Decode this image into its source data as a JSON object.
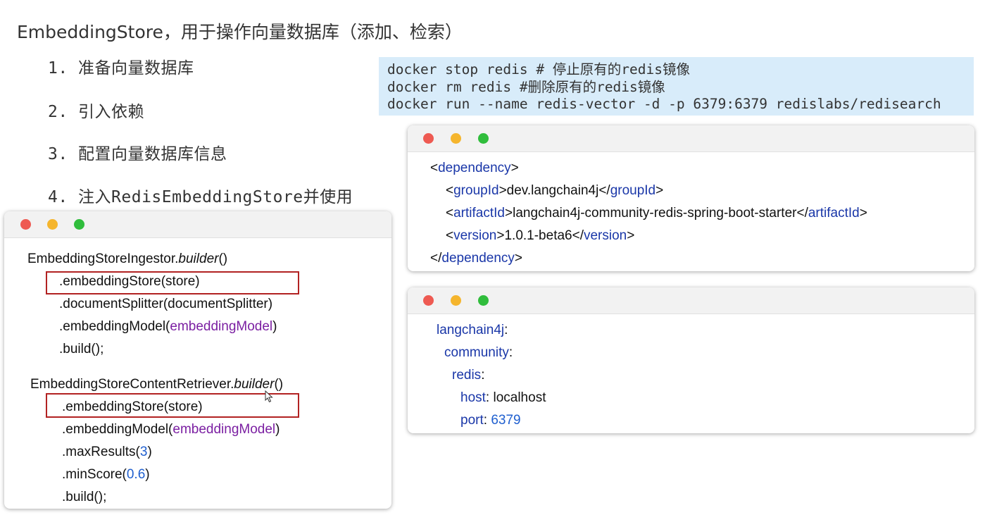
{
  "title": "EmbeddingStore，用于操作向量数据库（添加、检索）",
  "steps": [
    "1. 准备向量数据库",
    "2. 引入依赖",
    "3. 配置向量数据库信息",
    "4. 注入RedisEmbeddingStore并使用"
  ],
  "shell": {
    "line1": "docker stop redis # 停止原有的redis镜像",
    "line2": "docker rm redis #删除原有的redis镜像",
    "line3": "docker run --name redis-vector -d -p 6379:6379 redislabs/redisearch"
  },
  "maven": {
    "dependency": "dependency",
    "groupId": "groupId",
    "groupId_value": "dev.langchain4j",
    "artifactId": "artifactId",
    "artifactId_value": "langchain4j-community-redis-spring-boot-starter",
    "version": "version",
    "version_value": "1.0.1-beta6"
  },
  "yaml": {
    "root": "langchain4j",
    "community": "community",
    "redis": "redis",
    "host_key": "host",
    "host_value": "localhost",
    "port_key": "port",
    "port_value": "6379"
  },
  "java": {
    "ingestor_class": "EmbeddingStoreIngestor.",
    "builder": "builder",
    "ingestor_store": ".embeddingStore(store)",
    "ingestor_splitter": ".documentSplitter(documentSplitter)",
    "embedding_model_call": ".embeddingModel(",
    "embedding_model_arg": "embeddingModel",
    "build": ".build();",
    "retriever_class": "EmbeddingStoreContentRetriever.",
    "retriever_store": ".embeddingStore(store)",
    "max_results_call": ".maxResults(",
    "max_results_value": "3",
    "min_score_call": ".minScore(",
    "min_score_value": "0.6"
  },
  "colors": {
    "highlight_box": "#b22222",
    "shell_bg": "#d8ecfa",
    "keyword": "#1a37a8",
    "arg": "#7b1fa2",
    "number": "#1f5fcf"
  }
}
